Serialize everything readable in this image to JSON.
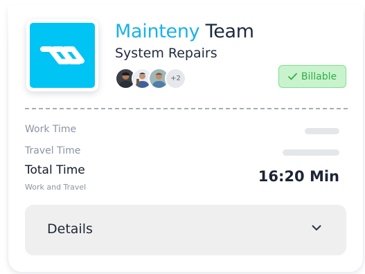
{
  "header": {
    "title_brand": "Mainteny",
    "title_rest": " Team",
    "subtitle": "System Repairs",
    "logo_icon": "mainteny-logo-icon",
    "avatar_overflow": "+2",
    "badge_label": "Billable",
    "badge_icon": "check-icon"
  },
  "times": {
    "work_label": "Work Time",
    "travel_label": "Travel Time",
    "total_label": "Total Time",
    "total_sublabel": "Work and Travel",
    "total_value": "16:20 Min"
  },
  "details": {
    "label": "Details",
    "icon": "chevron-down-icon"
  },
  "colors": {
    "brand_cyan": "#00c4f4",
    "title_brand": "#19b2e8",
    "badge_green": "#2fae47",
    "badge_bg": "#c9f3cd",
    "details_bg": "#efefef"
  }
}
